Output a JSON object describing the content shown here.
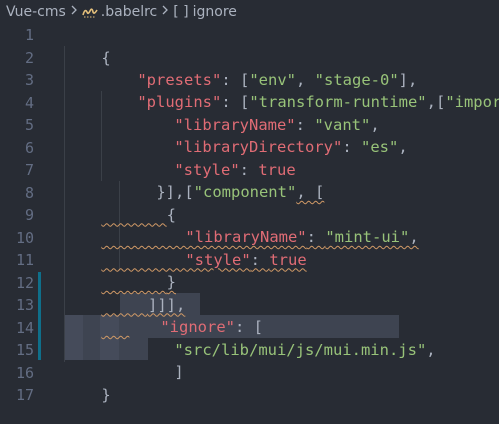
{
  "breadcrumb": {
    "project": "Vue-cms",
    "file": ".babelrc",
    "symbol_bracket": "[ ]",
    "symbol": "ignore"
  },
  "icons": {
    "separator": "chevron-right-icon",
    "file": "babel-file-icon",
    "symbol": "array-symbol-icon"
  },
  "colors": {
    "background": "#282c34",
    "key": "#e06c75",
    "string": "#98c379",
    "punctuation": "#abb2bf",
    "line_number": "#636d83",
    "warning_squiggle": "#d19a66",
    "selection": "#3e4451",
    "git_modified": "#0f6f8a"
  },
  "line_numbers": [
    "1",
    "2",
    "3",
    "4",
    "5",
    "6",
    "7",
    "8",
    "9",
    "10",
    "11",
    "12",
    "13",
    "14",
    "15",
    "16",
    "17"
  ],
  "code": {
    "l1": {
      "t0": "{"
    },
    "l2": {
      "t0": "\"presets\"",
      "t1": ": [",
      "t2": "\"env\"",
      "t3": ", ",
      "t4": "\"stage-0\"",
      "t5": "],"
    },
    "l3": {
      "t0": "\"plugins\"",
      "t1": ": [",
      "t2": "\"transform-runtime\"",
      "t3": ",[",
      "t4": "\"import\"",
      "t5": ", {"
    },
    "l4": {
      "t0": "\"libraryName\"",
      "t1": ": ",
      "t2": "\"vant\"",
      "t3": ","
    },
    "l5": {
      "t0": "\"libraryDirectory\"",
      "t1": ": ",
      "t2": "\"es\"",
      "t3": ","
    },
    "l6": {
      "t0": "\"style\"",
      "t1": ": ",
      "t2": "true"
    },
    "l7": {
      "t0": "}],[",
      "t1": "\"component\"",
      "t2": ", ["
    },
    "l8": {
      "t0": "{"
    },
    "l9": {
      "t0": "\"libraryName\"",
      "t1": ": ",
      "t2": "\"mint-ui\"",
      "t3": ","
    },
    "l10": {
      "t0": "\"style\"",
      "t1": ": ",
      "t2": "true"
    },
    "l11": {
      "t0": "}"
    },
    "l12": {
      "t0": "]]],"
    },
    "l13": {
      "t0": "\"ignore\"",
      "t1": ": ["
    },
    "l14": {
      "t0": "\"src/lib/mui/js/mui.min.js\"",
      "t1": ","
    },
    "l15": {
      "t0": "]"
    },
    "l16": {
      "t0": "}"
    },
    "l17": {
      "t0": ""
    }
  }
}
